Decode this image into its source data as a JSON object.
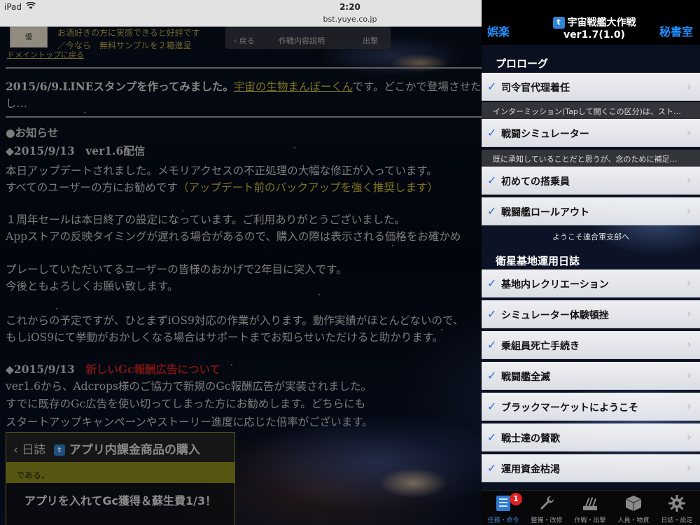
{
  "status_bar": {
    "device": "iPad",
    "time": "2:20",
    "url": "bst.yuye.co.jp"
  },
  "web": {
    "ad_thumb": "優",
    "ad_lines": [
      "お酒好きの方に実感できると好評です",
      "／今なら　無料サンプルを２箱進呈"
    ],
    "doc_top_link": "ドメイントップに戻る",
    "mini_box": {
      "back": "‹ 戻る",
      "mid": "作戦内容説明",
      "right": "出撃"
    },
    "news_line_prefix": "2015/6/9.LINEスタンプを作ってみました。",
    "news_link": "宇宙の生物まんぼーくん",
    "news_line_suffix": "です。どこかで登場させた",
    "news_line2": "し…",
    "notice_heading": "●お知らせ",
    "entry1_heading": "◆2015/9/13　ver1.6配信",
    "entry1_line1": "本日アップデートされました。メモリアクセスの不正処理の大幅な修正が入っています。",
    "entry1_line2_prefix": "すべてのユーザーの方にお勧めです",
    "entry1_line2_highlight": "（アップデート前のバックアップを強く推奨します）",
    "sale_line1": "１周年セールは本日終了の設定になっています。ご利用ありがとうございました。",
    "sale_line2": "Appストアの反映タイミングが遅れる場合があるので、購入の際は表示される価格をお確かめ",
    "thanks_line1": "プレーしていただいてるユーザーの皆様のおかげで2年目に突入です。",
    "thanks_line2": "今後ともよろしくお願い致します。",
    "plan_line1": "これからの予定ですが、ひとまずiOS9対応の作業が入ります。動作実績がほとんどないので、",
    "plan_line2": "もしiOS9にて挙動がおかしくなる場合はサポートまでお知らせいただけると助かります。",
    "entry2_heading_date": "◆2015/9/13",
    "entry2_heading_title": "新しいGc報酬広告について",
    "entry2_line1": "ver1.6から、Adcrops様のご協力で新規のGc報酬広告が実装されました。",
    "entry2_line2": "すでに既存のGc広告を使い切ってしまった方にお勧めします。どちらにも",
    "entry2_line3": "スタートアップキャンペーンやストーリー進度に応じた倍率がございます。",
    "panel": {
      "back": "‹ 日誌",
      "title": "アプリ内課金商品の購入",
      "yellow_text": "である。",
      "button": "アプリを入れてGc獲得＆蘇生費1/3！"
    }
  },
  "side": {
    "header": {
      "left": "娯楽",
      "right": "秘書室",
      "title_line1": "宇宙戦艦大作戦",
      "title_line2": "ver1.7(1.0)"
    },
    "section1": "プロローグ",
    "rows1": [
      "司令官代理着任"
    ],
    "note1": "インターミッション(Tapして開くこの区分)は、スト…",
    "row_sim": "戦闘シミュレーター",
    "note2": "既に承知していることだと思うが、念のために補足…",
    "row_crew": "初めての搭乗員",
    "row_rollout": "戦闘艦ロールアウト",
    "welcome": "ようこそ連合軍支部へ",
    "section2": "衛星基地運用日誌",
    "rows2": [
      "基地内レクリエーション",
      "シミュレーター体験頓挫",
      "乗組員死亡手続き",
      "戦闘艦全滅",
      "ブラックマーケットにようこそ",
      "戦士達の賛歌",
      "運用資金枯渇"
    ]
  },
  "tabbar": {
    "badge": "1",
    "tabs": [
      {
        "label": "任務・命令",
        "icon": "notebook-icon"
      },
      {
        "label": "整備・改修",
        "icon": "wrench-icon"
      },
      {
        "label": "作戦・出撃",
        "icon": "cannon-icon"
      },
      {
        "label": "人員・物資",
        "icon": "box-icon"
      },
      {
        "label": "日誌・設定",
        "icon": "gear-icon"
      }
    ]
  }
}
